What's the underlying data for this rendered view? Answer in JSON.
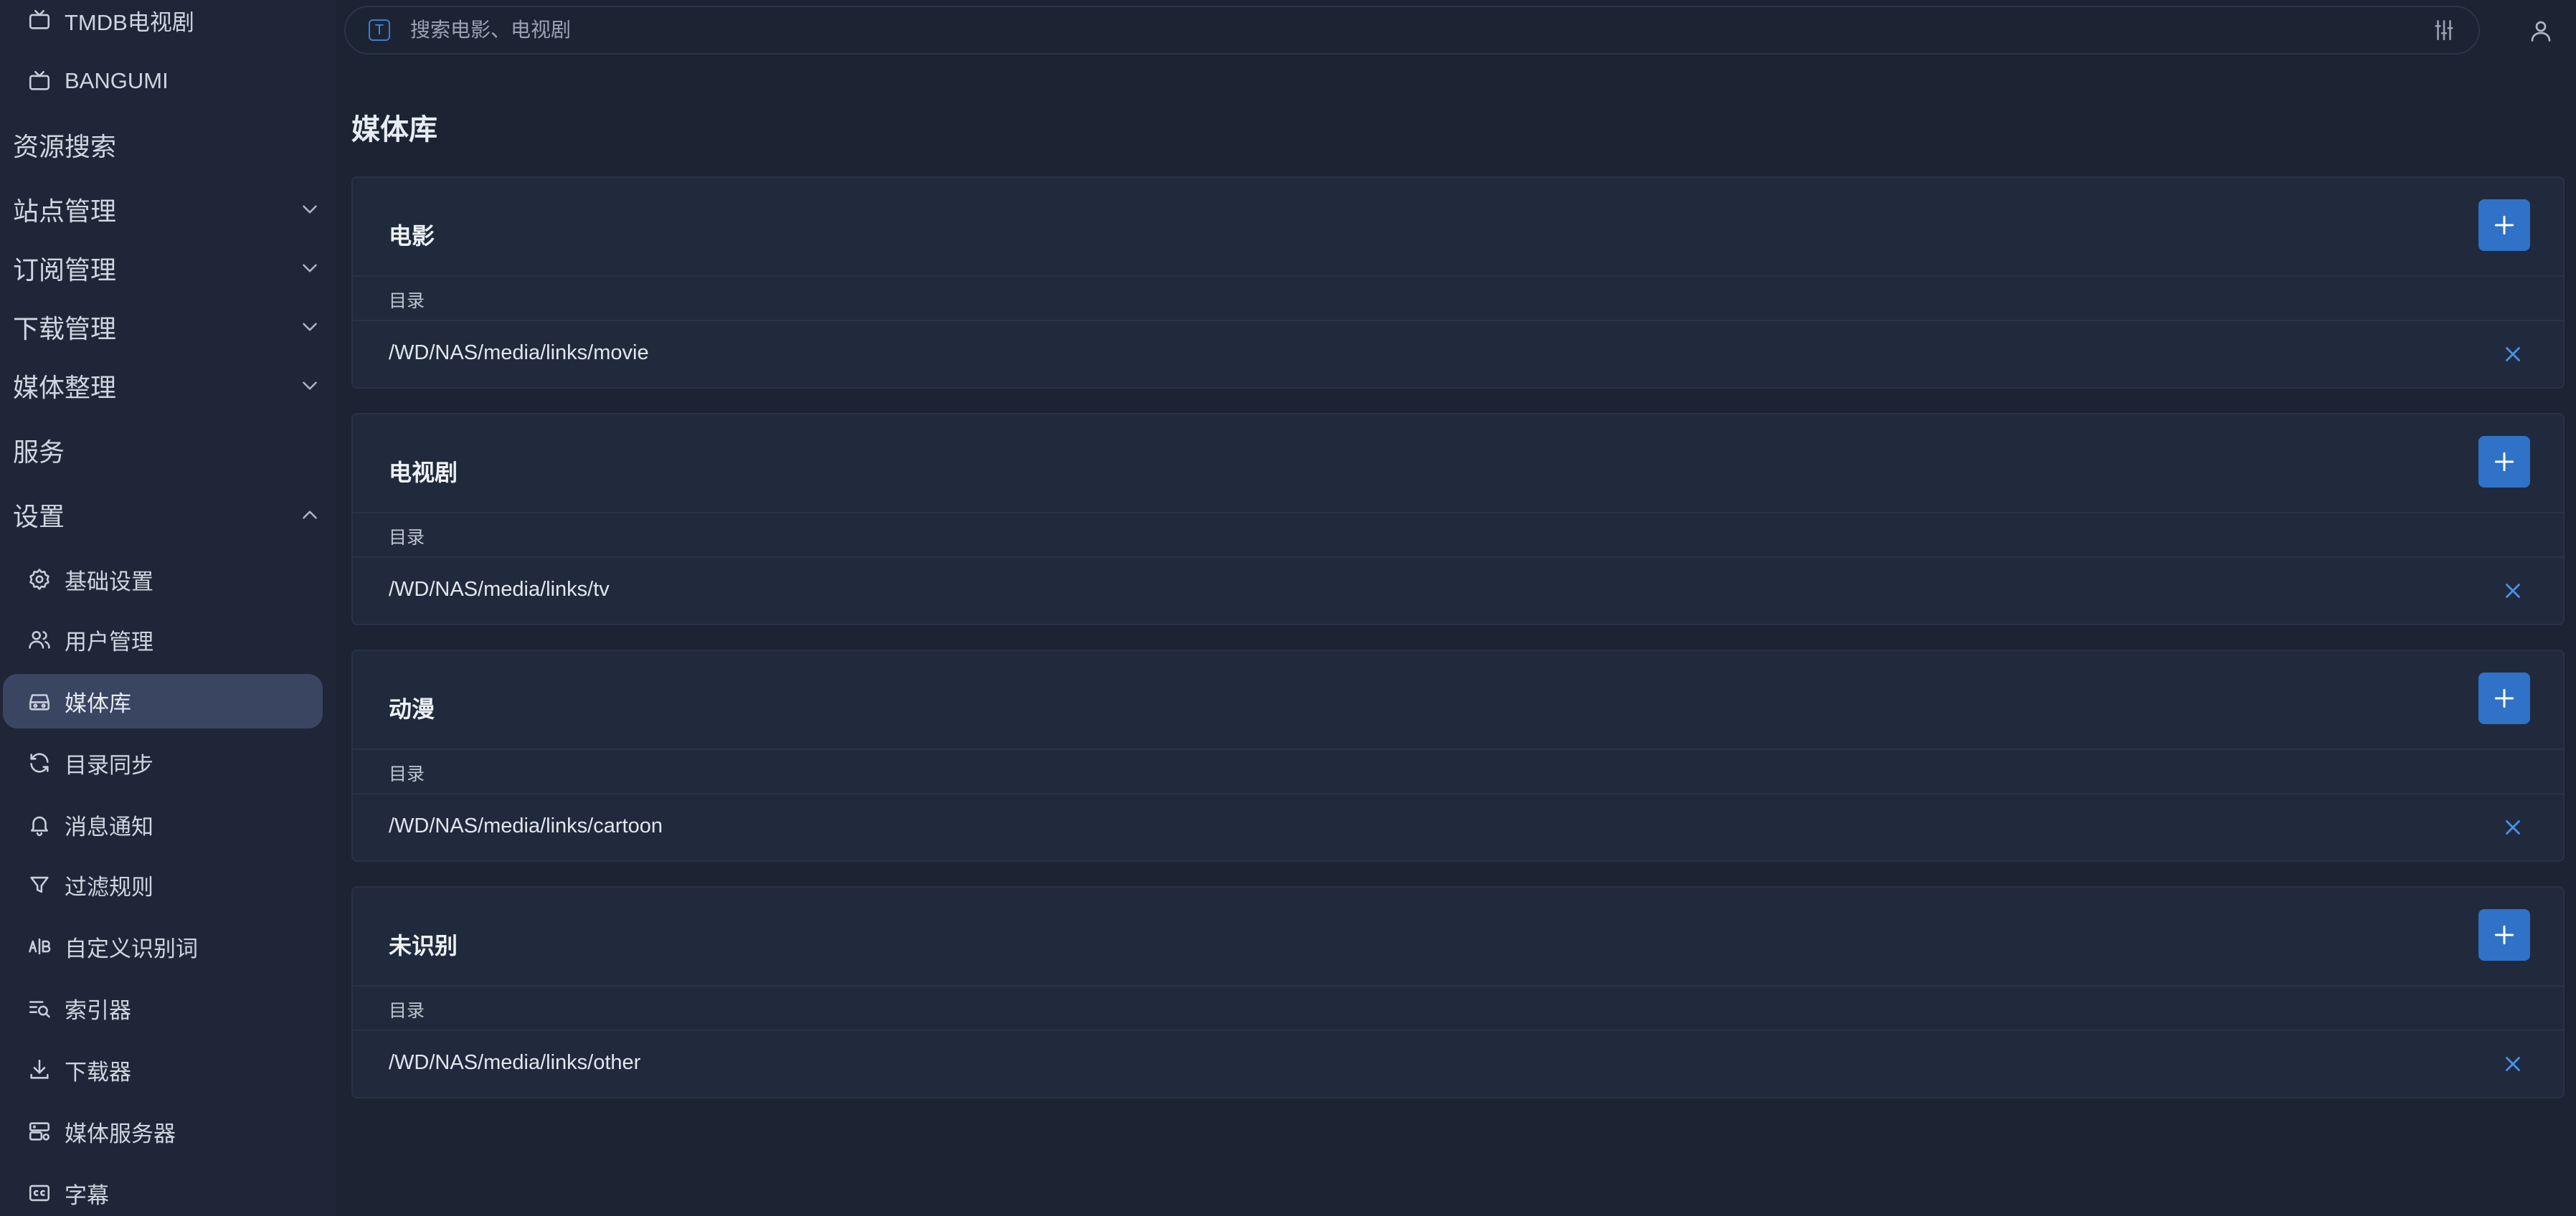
{
  "sidebar": {
    "top_items": [
      {
        "label": "TMDB电视剧",
        "icon": "tv-icon"
      },
      {
        "label": "BANGUMI",
        "icon": "tv-icon"
      }
    ],
    "groups": {
      "resource_search": "资源搜索",
      "site_management": "站点管理",
      "subscription_management": "订阅管理",
      "download_management": "下载管理",
      "media_organize": "媒体整理",
      "services": "服务",
      "settings": "设置"
    },
    "settings_items": [
      {
        "label": "基础设置",
        "icon": "gear-icon"
      },
      {
        "label": "用户管理",
        "icon": "users-icon"
      },
      {
        "label": "媒体库",
        "icon": "media-library-icon",
        "active": true
      },
      {
        "label": "目录同步",
        "icon": "sync-icon"
      },
      {
        "label": "消息通知",
        "icon": "bell-icon"
      },
      {
        "label": "过滤规则",
        "icon": "filter-icon"
      },
      {
        "label": "自定义识别词",
        "icon": "ab-icon"
      },
      {
        "label": "索引器",
        "icon": "indexer-icon"
      },
      {
        "label": "下载器",
        "icon": "download-icon"
      },
      {
        "label": "媒体服务器",
        "icon": "server-icon"
      },
      {
        "label": "字幕",
        "icon": "cc-icon"
      }
    ]
  },
  "search": {
    "placeholder": "搜索电影、电视剧",
    "value": "",
    "badge": "T"
  },
  "page": {
    "title": "媒体库"
  },
  "libraries": [
    {
      "name": "电影",
      "column_header": "目录",
      "path": "/WD/NAS/media/links/movie"
    },
    {
      "name": "电视剧",
      "column_header": "目录",
      "path": "/WD/NAS/media/links/tv"
    },
    {
      "name": "动漫",
      "column_header": "目录",
      "path": "/WD/NAS/media/links/cartoon"
    },
    {
      "name": "未识别",
      "column_header": "目录",
      "path": "/WD/NAS/media/links/other"
    }
  ],
  "colors": {
    "background": "#1c2434",
    "accent": "#2f72c8",
    "active_nav": "#3a4562"
  }
}
